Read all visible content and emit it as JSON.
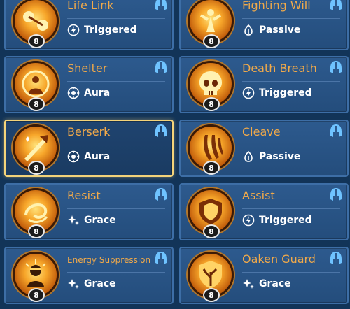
{
  "cards": [
    {
      "name": "Life Link",
      "type": "Triggered",
      "level": "8",
      "icon": "life-link-icon",
      "type_icon": "triggered-icon"
    },
    {
      "name": "Fighting Will",
      "type": "Passive",
      "level": "8",
      "icon": "fighting-will-icon",
      "type_icon": "passive-icon"
    },
    {
      "name": "Shelter",
      "type": "Aura",
      "level": "8",
      "icon": "shelter-icon",
      "type_icon": "aura-icon"
    },
    {
      "name": "Death Breath",
      "type": "Triggered",
      "level": "8",
      "icon": "death-breath-icon",
      "type_icon": "triggered-icon"
    },
    {
      "name": "Berserk",
      "type": "Aura",
      "level": "8",
      "icon": "berserk-icon",
      "type_icon": "aura-icon",
      "selected": true
    },
    {
      "name": "Cleave",
      "type": "Passive",
      "level": "8",
      "icon": "cleave-icon",
      "type_icon": "passive-icon"
    },
    {
      "name": "Resist",
      "type": "Grace",
      "level": "8",
      "icon": "resist-icon",
      "type_icon": "grace-icon"
    },
    {
      "name": "Assist",
      "type": "Triggered",
      "level": "8",
      "icon": "assist-icon",
      "type_icon": "triggered-icon"
    },
    {
      "name": "Energy Suppression",
      "type": "Grace",
      "level": "8",
      "icon": "energy-suppression-icon",
      "type_icon": "grace-icon"
    },
    {
      "name": "Oaken Guard",
      "type": "Grace",
      "level": "8",
      "icon": "oaken-guard-icon",
      "type_icon": "grace-icon"
    }
  ],
  "colors": {
    "name": "#f0a94a",
    "card": "#2d5a8e",
    "selected_border": "#f3d37a",
    "helmet": "#6fc3ff"
  }
}
